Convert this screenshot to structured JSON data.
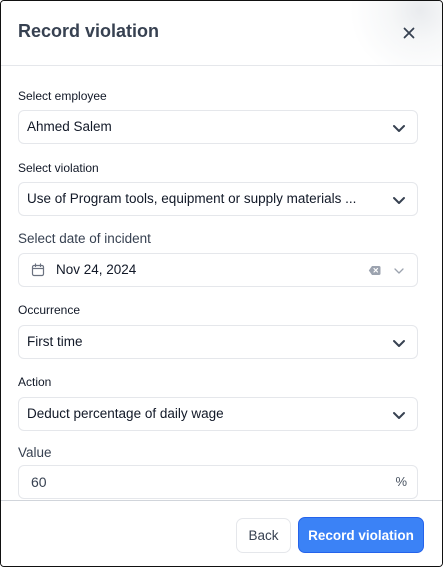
{
  "dialog": {
    "title": "Record violation",
    "close_icon": "close-icon"
  },
  "form": {
    "employee": {
      "label": "Select employee",
      "value": "Ahmed Salem"
    },
    "violation": {
      "label": "Select violation",
      "value": "Use of Program tools, equipment or supply materials ..."
    },
    "incident_date": {
      "label": "Select date of incident",
      "value": "Nov 24, 2024"
    },
    "occurrence": {
      "label": "Occurrence",
      "value": "First time"
    },
    "action": {
      "label": "Action",
      "value": "Deduct percentage of daily wage"
    },
    "amount": {
      "label": "Value",
      "value": "60",
      "suffix": "%"
    }
  },
  "footer": {
    "back_label": "Back",
    "submit_label": "Record violation"
  },
  "colors": {
    "primary": "#3b82f6",
    "border": "#e5e7eb",
    "text": "#111827"
  }
}
